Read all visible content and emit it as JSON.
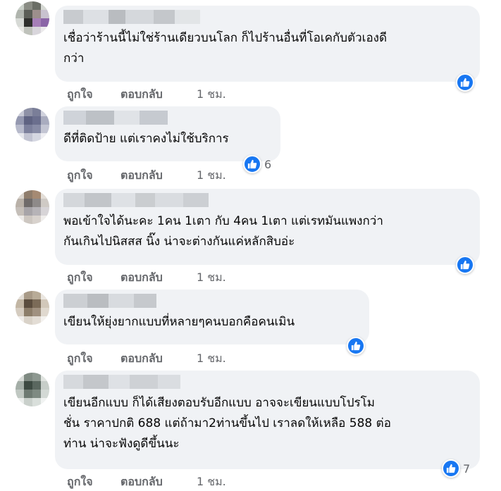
{
  "actions": {
    "like": "ถูกใจ",
    "reply": "ตอบกลับ"
  },
  "comments": [
    {
      "text": "เชื่อว่าร้านนี้ไม่ใช่ร้านเดียวบนโลก ก็ไปร้านอื่นที่โอเคกับตัวเองดีกว่า",
      "line1": "เชื่อว่าร้านนี้ไม่ใช่ร้านเดียวบนโลก ก็ไปร้านอื่นที่โอเคกับตัวเองดี",
      "line2": "กว่า",
      "time": "1 ชม.",
      "reaction_count": ""
    },
    {
      "line1": "ดีที่ติดป้าย แต่เราคงไม่ใช้บริการ",
      "time": "1 ชม.",
      "reaction_count": "6"
    },
    {
      "line1": "พอเข้าใจได้นะคะ 1คน 1เตา กับ 4คน 1เตา แต่เรทมันแพงกว่า",
      "line2": "กันเกินไปนิสสส นิ๊ง น่าจะต่างกันแค่หลักสิบอ่ะ",
      "time": "1 ชม.",
      "reaction_count": ""
    },
    {
      "line1": "เขียนให้ยุ่งยากแบบที่หลายๆคนบอกคือคนเมิน",
      "time": "1 ชม.",
      "reaction_count": ""
    },
    {
      "line1": "เขียนอีกแบบ ก็ได้เสียงตอบรับอีกแบบ อาจจะเขียนแบบโปรโม",
      "line2": "ชั่น ราคาปกติ 688 แต่ถ้ามา2ท่านขึ้นไป เราลดให้เหลือ 588 ต่อ",
      "line3": "ท่าน น่าจะฟังดูดีขึ้นนะ",
      "time": "1 ชม.",
      "reaction_count": "7"
    }
  ],
  "colors": {
    "bubble": "#f0f2f5",
    "like_blue": "#1877f2",
    "meta_gray": "#65676b"
  },
  "icons": {
    "reaction": "thumbs-up-icon"
  }
}
